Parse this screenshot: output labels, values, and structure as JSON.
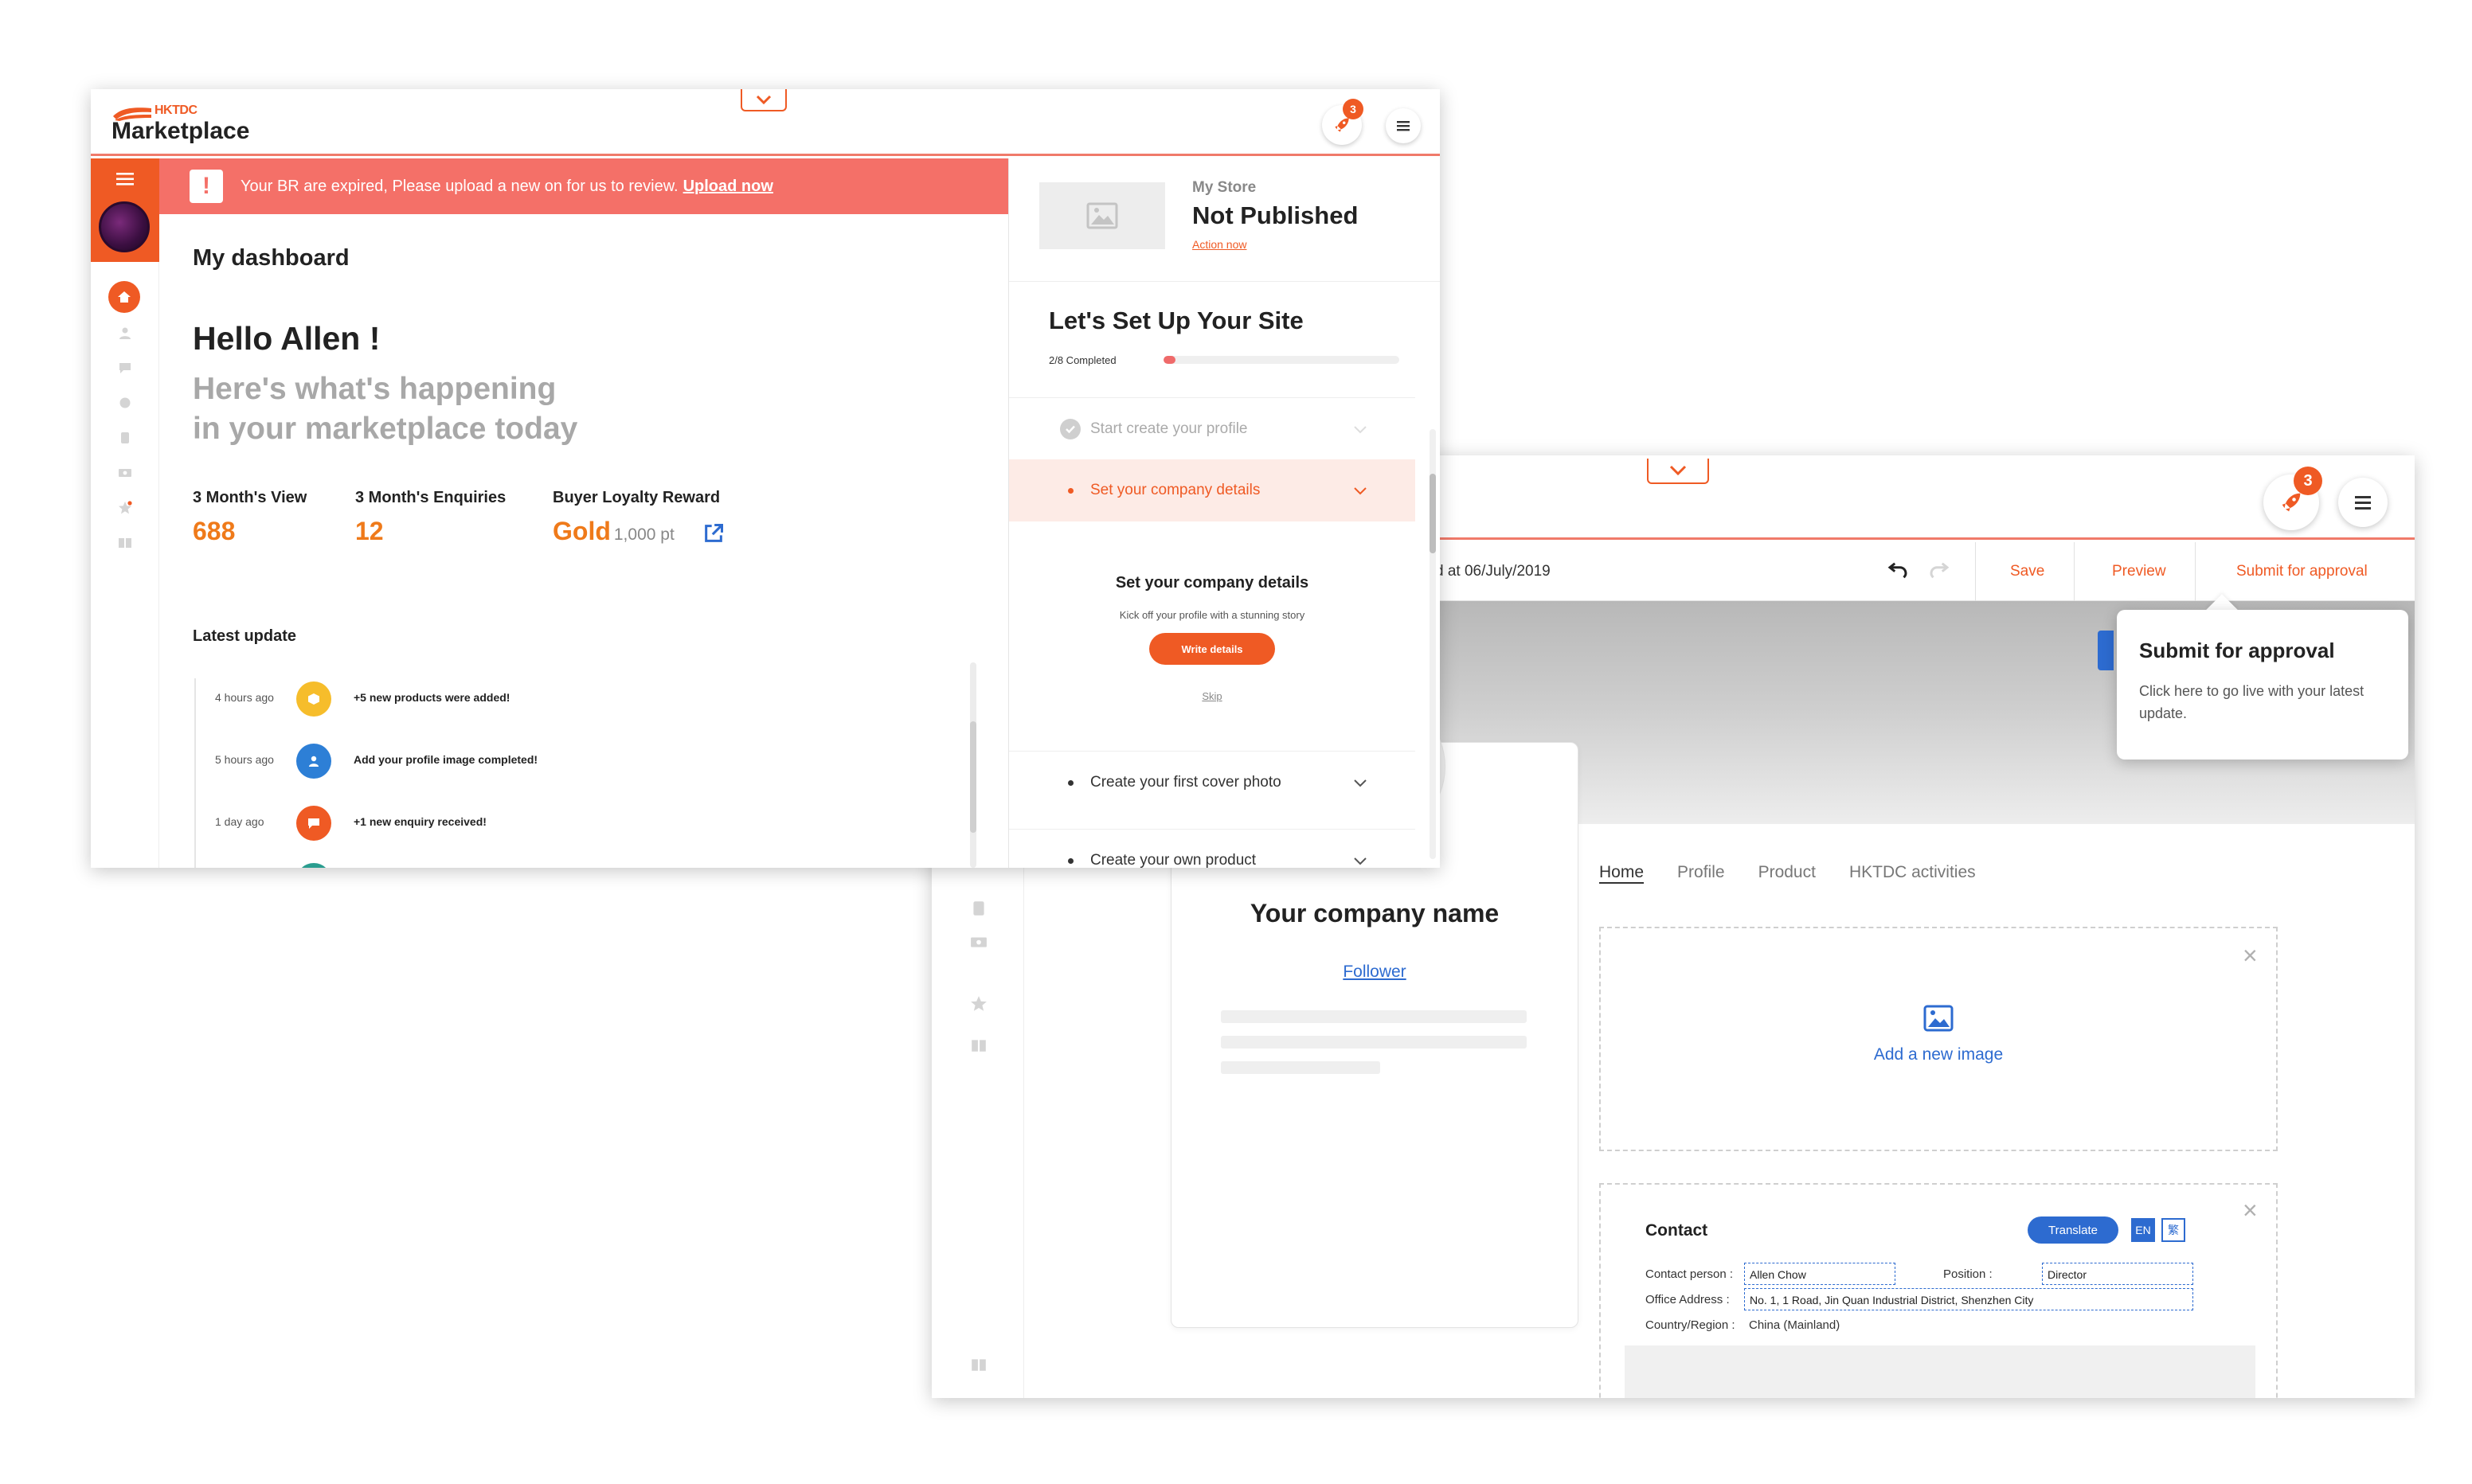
{
  "editor": {
    "saved_text": "d at 06/July/2019",
    "toolbar": {
      "save": "Save",
      "preview": "Preview",
      "submit": "Submit for approval"
    },
    "notifications": {
      "count": "3"
    },
    "tooltip": {
      "title": "Submit for approval",
      "body": "Click here to go live with your latest update."
    },
    "profile": {
      "company_name": "Your company name",
      "follower": "Follower"
    },
    "nav": [
      "Home",
      "Profile",
      "Product",
      "HKTDC activities"
    ],
    "image_box": {
      "label": "Add a new image"
    },
    "contact": {
      "title": "Contact",
      "translate": "Translate",
      "lang_en": "EN",
      "lang_zh": "繁",
      "contact_person_label": "Contact person :",
      "contact_person": "Allen Chow",
      "position_label": "Position :",
      "position": "Director",
      "office_label": "Office Address :",
      "office": "No. 1, 1 Road, Jin Quan Industrial District, Shenzhen City",
      "country_label": "Country/Region :",
      "country": "China (Mainland)"
    }
  },
  "dashboard": {
    "logo_small": "HKTDC",
    "logo_big": "Marketplace",
    "notifications": {
      "count": "3"
    },
    "alert": {
      "text": "Your BR are expired, Please upload a new on for us to review.",
      "link": "Upload now"
    },
    "title": "My dashboard",
    "greeting": "Hello Allen !",
    "subtitle_line1": "Here's what's happening",
    "subtitle_line2": "in your marketplace today",
    "stats": [
      {
        "label": "3 Month's View",
        "value": "688",
        "unit": ""
      },
      {
        "label": "3 Month's Enquiries",
        "value": "12",
        "unit": ""
      },
      {
        "label": "Buyer Loyalty Reward",
        "value": "Gold",
        "unit": "1,000 pt"
      }
    ],
    "latest_title": "Latest update",
    "feed": [
      {
        "time": "4 hours ago",
        "message": "+5 new products were added!",
        "color": "#f6bd2b"
      },
      {
        "time": "5 hours ago",
        "message": "Add your profile image completed!",
        "color": "#2d7fd6"
      },
      {
        "time": "1 day ago",
        "message": "+1 new enquiry received!",
        "color": "#ef5a24"
      }
    ],
    "store": {
      "label": "My Store",
      "status": "Not Published",
      "action": "Action now"
    },
    "setup": {
      "title": "Let's Set Up Your Site",
      "count": "2/8 Completed",
      "progress": 0.05,
      "steps": [
        {
          "label": "Start create your profile",
          "state": "done"
        },
        {
          "label": "Set your company details",
          "state": "active"
        },
        {
          "label": "Create your first cover photo",
          "state": "todo"
        },
        {
          "label": "Create your own product",
          "state": "todo"
        }
      ],
      "panel": {
        "title": "Set your company details",
        "body": "Kick off your profile with a stunning story",
        "button": "Write details",
        "skip": "Skip"
      }
    }
  },
  "colors": {
    "accent": "#ef5a24",
    "alert": "#f47068",
    "stat": "#ef7a1a",
    "link": "#2d6bd0"
  }
}
